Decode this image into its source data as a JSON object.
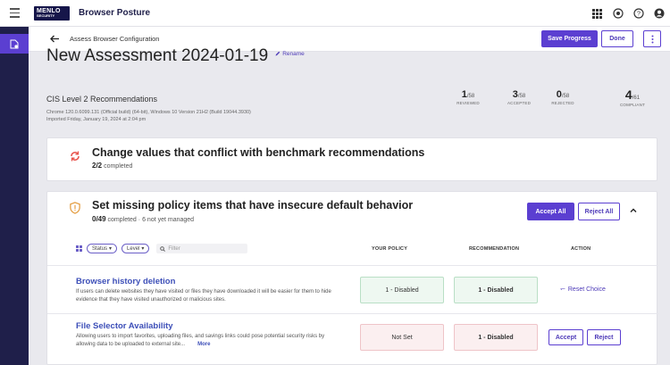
{
  "topbar": {
    "logo_line1": "MENLO",
    "logo_line2": "SECURITY",
    "app_title": "Browser Posture"
  },
  "subbar": {
    "breadcrumb": "Assess Browser Configuration",
    "save_label": "Save Progress",
    "done_label": "Done"
  },
  "assessment": {
    "title": "New Assessment 2024-01-19",
    "rename_label": "Rename",
    "subtitle": "CIS Level 2 Recommendations",
    "meta_line1": "Chrome 120.0.6099.131 (Official build) (64-bit), Windows 10 Version 21H2 (Build 19044.3930)",
    "meta_line2": "Imported Friday, January 19, 2024 at 2:04 pm"
  },
  "stats": [
    {
      "value": "1",
      "total": "/58",
      "label": "REVIEWED"
    },
    {
      "value": "3",
      "total": "/58",
      "label": "ACCEPTED"
    },
    {
      "value": "0",
      "total": "/58",
      "label": "REJECTED"
    },
    {
      "value": "4",
      "total": "/61",
      "label": "COMPLIANT"
    }
  ],
  "section1": {
    "title": "Change values that conflict with benchmark recommendations",
    "count": "2/2",
    "count_suffix": "completed"
  },
  "section2": {
    "title": "Set missing policy items that have insecure default behavior",
    "count": "0/49",
    "count_suffix": "completed",
    "extra": "6",
    "extra_suffix": "not yet managed",
    "accept_all": "Accept All",
    "reject_all": "Reject All",
    "filters": {
      "status": "Status",
      "level": "Level",
      "placeholder": "Filter"
    },
    "columns": {
      "policy": "YOUR POLICY",
      "recommendation": "RECOMMENDATION",
      "action": "ACTION"
    },
    "rows": [
      {
        "name": "Browser history deletion",
        "description": "If users can delete websites they have visited or files they have downloaded it will be easier for them to hide evidence that they have visited unauthorized or malicious sites.",
        "policy": "1 - Disabled",
        "recommendation": "1 - Disabled",
        "action": "Reset Choice"
      },
      {
        "name": "File Selector Availability",
        "description": "Allowing users to import favorites, uploading files, and savings links could pose potential security risks by allowing data to be uploaded to external site...",
        "more": "More",
        "policy": "Not Set",
        "recommendation": "1 - Disabled",
        "accept": "Accept",
        "reject": "Reject"
      }
    ]
  }
}
